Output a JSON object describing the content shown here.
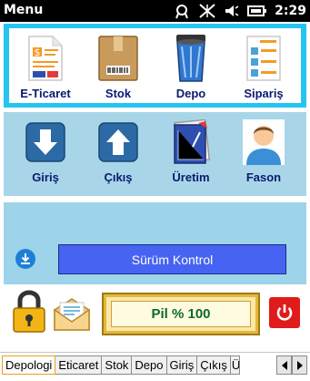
{
  "statusbar": {
    "title": "Menu",
    "clock": "2:29"
  },
  "top_tiles": [
    {
      "label": "E-Ticaret",
      "icon": "invoice-icon"
    },
    {
      "label": "Stok",
      "icon": "box-icon"
    },
    {
      "label": "Depo",
      "icon": "trash-bin-icon"
    },
    {
      "label": "Sipariş",
      "icon": "order-form-icon"
    }
  ],
  "mid_tiles": [
    {
      "label": "Giriş",
      "icon": "arrow-down-icon"
    },
    {
      "label": "Çıkış",
      "icon": "arrow-up-icon"
    },
    {
      "label": "Üretim",
      "icon": "chart-document-icon"
    },
    {
      "label": "Fason",
      "icon": "person-icon"
    }
  ],
  "update": {
    "label": "Sürüm Kontrol"
  },
  "battery": {
    "text": "Pil % 100"
  },
  "tabs": [
    "Depologi",
    "Eticaret",
    "Stok",
    "Depo",
    "Giriş",
    "Çıkış",
    "Ü"
  ],
  "active_tab": "Depologi",
  "colors": {
    "accent": "#26c5f0",
    "button": "#4763f2",
    "label": "#0b1a70",
    "power": "#e01b1b"
  }
}
